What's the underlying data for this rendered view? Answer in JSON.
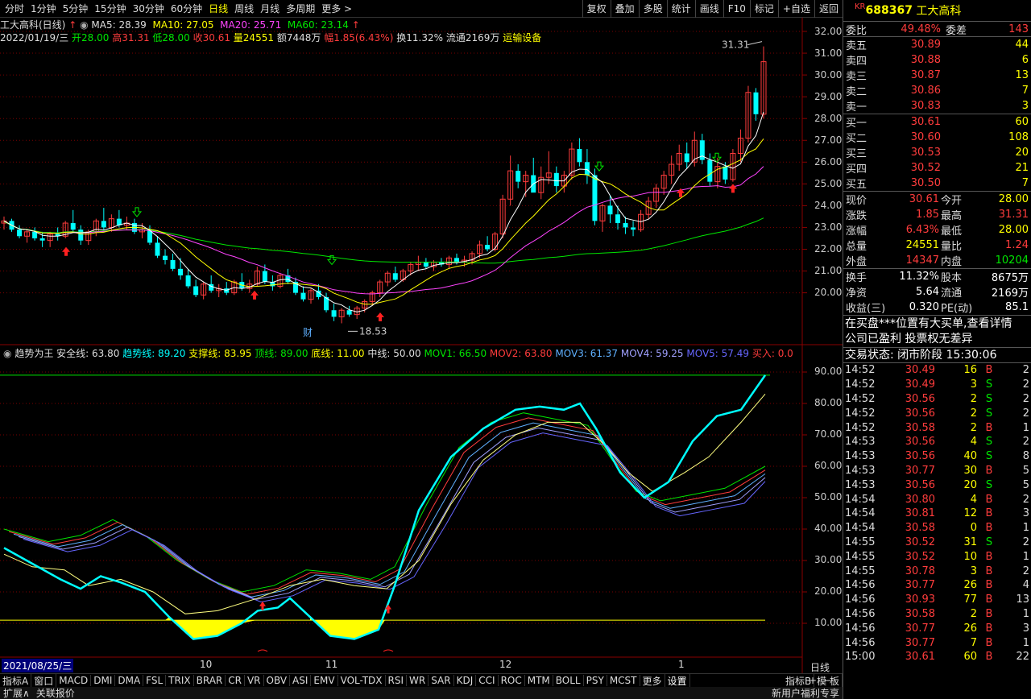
{
  "periods": [
    "分时",
    "1分钟",
    "5分钟",
    "15分钟",
    "30分钟",
    "60分钟",
    "日线",
    "周线",
    "月线",
    "多周期",
    "更多 >"
  ],
  "active_period": "日线",
  "tools": [
    "复权",
    "叠加",
    "多股",
    "统计",
    "画线",
    "F10",
    "标记",
    "+自选",
    "返回"
  ],
  "chart_title": "工大高科(日线)",
  "ma": {
    "ma5": "MA5: 28.39",
    "ma10": "MA10: 27.05",
    "ma20": "MA20: 25.71",
    "ma60": "MA60: 23.14"
  },
  "info": {
    "date": "2022/01/19/三",
    "open": "开28.00",
    "high": "高31.31",
    "low": "低28.00",
    "close": "收30.61",
    "vol": "量24551",
    "amt": "额7448万",
    "pct": "幅1.85(6.43%)",
    "turn": "换11.32%",
    "float": "流通2169万",
    "industry": "运输设备"
  },
  "price_axis": [
    "32.00",
    "31.00",
    "30.00",
    "29.00",
    "28.00",
    "27.00",
    "26.00",
    "25.00",
    "24.00",
    "23.00",
    "22.00",
    "21.00",
    "20.00"
  ],
  "high_mark": "31.31",
  "low_mark": "18.53",
  "cai_mark": "财",
  "indicator": {
    "name": "趋势为王",
    "safe": "安全线: 63.80",
    "trend": "趋势线: 89.20",
    "support": "支撑线: 83.95",
    "top": "顶线: 89.00",
    "bottom": "底线: 11.00",
    "mid": "中线: 50.00",
    "mov1": "MOV1: 66.50",
    "mov2": "MOV2: 63.80",
    "mov3": "MOV3: 61.37",
    "mov4": "MOV4: 59.25",
    "mov5": "MOV5: 57.49",
    "buy": "买入: 0.0"
  },
  "ind_axis": [
    "90.00",
    "80.00",
    "70.00",
    "60.00",
    "50.00",
    "40.00",
    "30.00",
    "20.00",
    "10.00"
  ],
  "date_axis": {
    "start": "2021/08/25/三",
    "m10": "10",
    "m11": "11",
    "m12": "12",
    "m1": "1",
    "mode": "日线"
  },
  "bottom_tabs": [
    "指标A",
    "窗口",
    "MACD",
    "DMI",
    "DMA",
    "FSL",
    "TRIX",
    "BRAR",
    "CR",
    "VR",
    "OBV",
    "ASI",
    "EMV",
    "VOL-TDX",
    "RSI",
    "WR",
    "SAR",
    "KDJ",
    "CCI",
    "ROC",
    "MTM",
    "BOLL",
    "PSY",
    "MCST",
    "更多",
    "设置",
    "指标B",
    "模 板"
  ],
  "status_left": [
    "扩展∧",
    "关联报价"
  ],
  "status_right": "新用户福利专享",
  "quote": {
    "code": "688367",
    "name": "工大高科",
    "tag": "KR",
    "weibi_label": "委比",
    "weibi": "49.48%",
    "weicha_label": "委差",
    "weicha": "143",
    "sells": [
      {
        "l": "卖五",
        "p": "30.89",
        "v": "44"
      },
      {
        "l": "卖四",
        "p": "30.88",
        "v": "6"
      },
      {
        "l": "卖三",
        "p": "30.87",
        "v": "13"
      },
      {
        "l": "卖二",
        "p": "30.86",
        "v": "7"
      },
      {
        "l": "卖一",
        "p": "30.83",
        "v": "3"
      }
    ],
    "buys": [
      {
        "l": "买一",
        "p": "30.61",
        "v": "60"
      },
      {
        "l": "买二",
        "p": "30.60",
        "v": "108"
      },
      {
        "l": "买三",
        "p": "30.53",
        "v": "20"
      },
      {
        "l": "买四",
        "p": "30.52",
        "v": "21"
      },
      {
        "l": "买五",
        "p": "30.50",
        "v": "7"
      }
    ],
    "stats": [
      {
        "a": "现价",
        "b": "30.61",
        "c": "今开",
        "d": "28.00",
        "bc": "red",
        "dc": "yellow"
      },
      {
        "a": "涨跌",
        "b": "1.85",
        "c": "最高",
        "d": "31.31",
        "bc": "red",
        "dc": "red"
      },
      {
        "a": "涨幅",
        "b": "6.43%",
        "c": "最低",
        "d": "28.00",
        "bc": "red",
        "dc": "yellow"
      },
      {
        "a": "总量",
        "b": "24551",
        "c": "量比",
        "d": "1.24",
        "bc": "yellow",
        "dc": "red"
      },
      {
        "a": "外盘",
        "b": "14347",
        "c": "内盘",
        "d": "10204",
        "bc": "red",
        "dc": "green"
      }
    ],
    "stats2": [
      {
        "a": "换手",
        "b": "11.32%",
        "c": "股本",
        "d": "8675万"
      },
      {
        "a": "净资",
        "b": "5.64",
        "c": "流通",
        "d": "2169万"
      },
      {
        "a": "收益(三)",
        "b": "0.320",
        "c": "PE(动)",
        "d": "85.1"
      }
    ],
    "notice1": "在买盘***位置有大买单,查看详情",
    "notice2": "公司已盈利 投票权无差异",
    "state": "交易状态: 闭市阶段 15:30:06",
    "ticks": [
      {
        "t": "14:52",
        "p": "30.49",
        "v": "16",
        "bs": "B",
        "e": "2"
      },
      {
        "t": "14:52",
        "p": "30.49",
        "v": "3",
        "bs": "S",
        "e": "2"
      },
      {
        "t": "14:52",
        "p": "30.56",
        "v": "2",
        "bs": "S",
        "e": "2"
      },
      {
        "t": "14:52",
        "p": "30.56",
        "v": "2",
        "bs": "S",
        "e": "2"
      },
      {
        "t": "14:52",
        "p": "30.58",
        "v": "2",
        "bs": "B",
        "e": "1"
      },
      {
        "t": "14:53",
        "p": "30.56",
        "v": "4",
        "bs": "S",
        "e": "2"
      },
      {
        "t": "14:53",
        "p": "30.56",
        "v": "40",
        "bs": "S",
        "e": "8"
      },
      {
        "t": "14:53",
        "p": "30.77",
        "v": "30",
        "bs": "B",
        "e": "5"
      },
      {
        "t": "14:53",
        "p": "30.56",
        "v": "20",
        "bs": "S",
        "e": "5"
      },
      {
        "t": "14:54",
        "p": "30.80",
        "v": "4",
        "bs": "B",
        "e": "2"
      },
      {
        "t": "14:54",
        "p": "30.81",
        "v": "12",
        "bs": "B",
        "e": "3"
      },
      {
        "t": "14:54",
        "p": "30.58",
        "v": "0",
        "bs": "B",
        "e": "1"
      },
      {
        "t": "14:55",
        "p": "30.52",
        "v": "31",
        "bs": "S",
        "e": "2"
      },
      {
        "t": "14:55",
        "p": "30.52",
        "v": "10",
        "bs": "B",
        "e": "1"
      },
      {
        "t": "14:55",
        "p": "30.78",
        "v": "3",
        "bs": "B",
        "e": "2"
      },
      {
        "t": "14:56",
        "p": "30.77",
        "v": "26",
        "bs": "B",
        "e": "4"
      },
      {
        "t": "14:56",
        "p": "30.93",
        "v": "77",
        "bs": "B",
        "e": "13"
      },
      {
        "t": "14:56",
        "p": "30.58",
        "v": "2",
        "bs": "B",
        "e": "1"
      },
      {
        "t": "14:56",
        "p": "30.77",
        "v": "26",
        "bs": "B",
        "e": "3"
      },
      {
        "t": "14:56",
        "p": "30.77",
        "v": "7",
        "bs": "B",
        "e": "1"
      },
      {
        "t": "15:00",
        "p": "30.61",
        "v": "60",
        "bs": "B",
        "e": "22"
      }
    ]
  },
  "colors": {
    "up": "#ff3c3c",
    "down": "#00ffff",
    "ma5": "#ffffff",
    "ma10": "#ffff00",
    "ma20": "#ff44ff",
    "ma60": "#00e600"
  }
}
